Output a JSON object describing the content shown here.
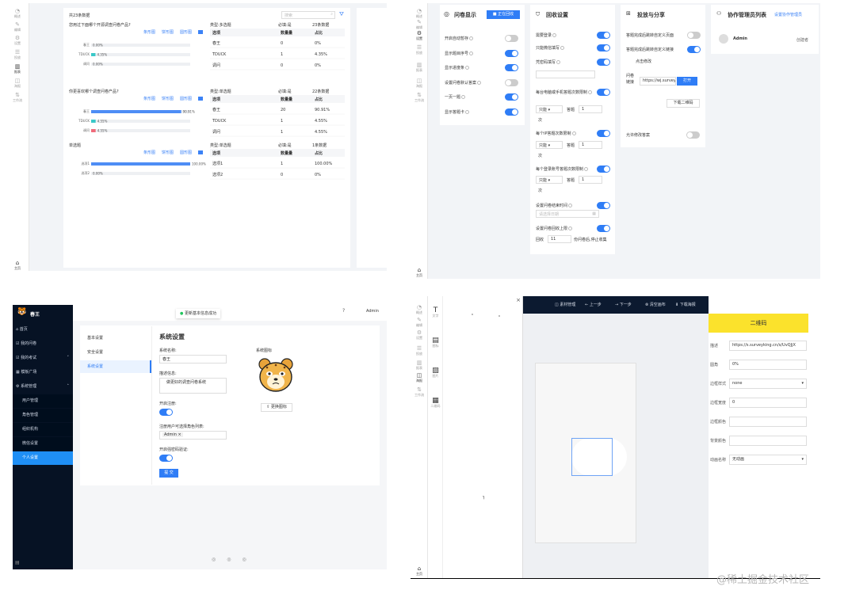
{
  "stats": {
    "total": "共23条数据",
    "search_ph": "搜索",
    "sidebar": [
      {
        "label": "概述",
        "icon": "◔"
      },
      {
        "label": "编辑",
        "icon": "✎"
      },
      {
        "label": "设置",
        "icon": "⚙"
      },
      {
        "label": "投放",
        "icon": "☰"
      },
      {
        "label": "报表",
        "icon": "▥"
      },
      {
        "label": "海报",
        "icon": "◫"
      },
      {
        "label": "工作流",
        "icon": "⇅"
      }
    ],
    "home": "主页",
    "chart_links": [
      "条形图",
      "饼形图",
      "圆形图"
    ],
    "chart_data": [
      {
        "type": "bar",
        "question": "您用过下面哪个开源调查问卷产品?",
        "qtype": "类型:多选题",
        "required": "必填:是",
        "count": "23条数据",
        "categories": [
          "春王",
          "TDUCK",
          "调问"
        ],
        "values": [
          0,
          4.35,
          0
        ],
        "labels": [
          "0.00%",
          "4.35%",
          "0.00%"
        ],
        "counts": [
          "0",
          "1",
          "0"
        ],
        "pcts": [
          "0%",
          "4.35%",
          "0%"
        ],
        "color": "#3ac8c8"
      },
      {
        "type": "bar",
        "question": "你更喜欢哪个调查问卷产品?",
        "qtype": "类型:单选题",
        "required": "必填:是",
        "count": "22条数据",
        "categories": [
          "春王",
          "TDUCK",
          "调问"
        ],
        "values": [
          90.91,
          4.55,
          4.55
        ],
        "labels": [
          "90.91%",
          "4.55%",
          "4.55%"
        ],
        "counts": [
          "20",
          "1",
          "1"
        ],
        "pcts": [
          "90.91%",
          "4.55%",
          "4.55%"
        ],
        "colors": [
          "#4e8df5",
          "#3ac8c8",
          "#f06b7b"
        ]
      },
      {
        "type": "bar",
        "question": "单选题",
        "qtype": "类型:单选题",
        "required": "必填:是",
        "count": "1条数据",
        "categories": [
          "选项1",
          "选项2"
        ],
        "values": [
          100,
          0
        ],
        "labels": [
          "100.00%",
          "0.00%"
        ],
        "counts": [
          "1",
          "0"
        ],
        "pcts": [
          "100.00%",
          "0%"
        ],
        "color": "#4e8df5"
      }
    ],
    "table_headers": [
      "选项",
      "数量量",
      "占比"
    ]
  },
  "settings": {
    "sidebar": [
      {
        "label": "概述",
        "icon": "◔"
      },
      {
        "label": "编辑",
        "icon": "✎"
      },
      {
        "label": "设置",
        "icon": "⚙"
      },
      {
        "label": "投放",
        "icon": "☰"
      },
      {
        "label": "报表",
        "icon": "▥"
      },
      {
        "label": "海报",
        "icon": "◫"
      },
      {
        "label": "工作流",
        "icon": "⇅"
      }
    ],
    "home": "主页",
    "display_title": "问卷显示",
    "collecting": "正在回收",
    "display_items": [
      {
        "label": "开启自动暂存",
        "on": false
      },
      {
        "label": "显示题目序号",
        "on": true
      },
      {
        "label": "显示进度条",
        "on": true
      },
      {
        "label": "设置问卷默认答案",
        "on": false
      },
      {
        "label": "一页一题",
        "on": true
      },
      {
        "label": "显示答题卡",
        "on": true
      }
    ],
    "recycle_title": "回收设置",
    "recycle_items": [
      {
        "label": "需要登录",
        "on": true
      },
      {
        "label": "只能微信填写",
        "on": true
      },
      {
        "label": "凭密码填写",
        "on": true
      },
      {
        "label": "每台电脑或手机答题次数限制",
        "on": true
      },
      {
        "label": "每个IP答题次数限制",
        "on": true
      },
      {
        "label": "每个登录账号答题次数限制",
        "on": true
      },
      {
        "label": "设置问卷结束时间",
        "on": true
      },
      {
        "label": "设置问卷回收上限",
        "on": true
      }
    ],
    "limit_select": "只能",
    "limit_mid": "答题",
    "limit_val": "1",
    "limit_unit": "次",
    "end_date_ph": "请选择日期",
    "cap_prefix": "回收",
    "cap_val": "11",
    "cap_suffix": "份问卷后,停止收集",
    "share_title": "投放与分享",
    "share_items": [
      {
        "label": "答题完成后跳转自定义页面",
        "on": false
      },
      {
        "label": "答题完成后跳转自定义链接",
        "on": true
      }
    ],
    "click_edit": "点击修改",
    "link_label": "问卷链接",
    "link_val": "https://wj.surveyki",
    "open_btn": "打开",
    "qr_btn": "下载二维码",
    "allow_edit": "允许修改答案",
    "collab_title": "协作管理员列表",
    "collab_set": "设置协作管理员",
    "admin": "Admin",
    "creator": "创建者"
  },
  "system": {
    "brand": "春王",
    "toast": "更新基本信息成功",
    "user": "Admin",
    "nav": [
      {
        "label": "首页",
        "icon": "⌂"
      },
      {
        "label": "我的问卷",
        "icon": "☑"
      },
      {
        "label": "我的考试",
        "icon": "☑"
      },
      {
        "label": "模板广场",
        "icon": "▦"
      },
      {
        "label": "系统管理",
        "icon": "⚙"
      }
    ],
    "subnav": [
      "用户管理",
      "角色管理",
      "组织机构",
      "微信设置",
      "个人设置"
    ],
    "tabs": [
      "基本设置",
      "安全设置",
      "系统设置"
    ],
    "title": "系统设置",
    "name_label": "系统名称:",
    "name_val": "春王",
    "desc_label": "描述信息:",
    "desc_val": "做更好的调查问卷系统",
    "reg_label": "开启注册:",
    "roles_label": "注册用户可选择角色列表:",
    "role_tag": "Admin",
    "captcha_label": "开启强密码验证:",
    "submit": "提 交",
    "icon_label": "系统图标",
    "change_icon": "更换图标"
  },
  "poster": {
    "toolbar": [
      "素材管理",
      "上一步",
      "下一步",
      "清空画布",
      "下载海报"
    ],
    "sidebar": [
      {
        "label": "概述",
        "icon": "◔"
      },
      {
        "label": "编辑",
        "icon": "✎"
      },
      {
        "label": "设置",
        "icon": "⚙"
      },
      {
        "label": "投放",
        "icon": "☰"
      },
      {
        "label": "报表",
        "icon": "▥"
      },
      {
        "label": "海报",
        "icon": "◫"
      },
      {
        "label": "工作流",
        "icon": "⇅"
      }
    ],
    "home": "主页",
    "tools": [
      {
        "label": "文字",
        "icon": "T"
      },
      {
        "label": "图标",
        "icon": "▤"
      },
      {
        "label": "图片",
        "icon": "▨"
      },
      {
        "label": "二维码",
        "icon": "▦"
      }
    ],
    "props_title": "二维码",
    "props": [
      {
        "label": "描述",
        "val": "https://s.surveyking.cn/s/UvQJjX"
      },
      {
        "label": "圆角",
        "val": "0%"
      },
      {
        "label": "边框样式",
        "val": "none"
      },
      {
        "label": "边框宽度",
        "val": "0"
      },
      {
        "label": "边框颜色",
        "val": ""
      },
      {
        "label": "背景颜色",
        "val": ""
      },
      {
        "label": "动画名称",
        "val": "无动画"
      }
    ]
  },
  "watermark": "@稀土掘金技术社区"
}
